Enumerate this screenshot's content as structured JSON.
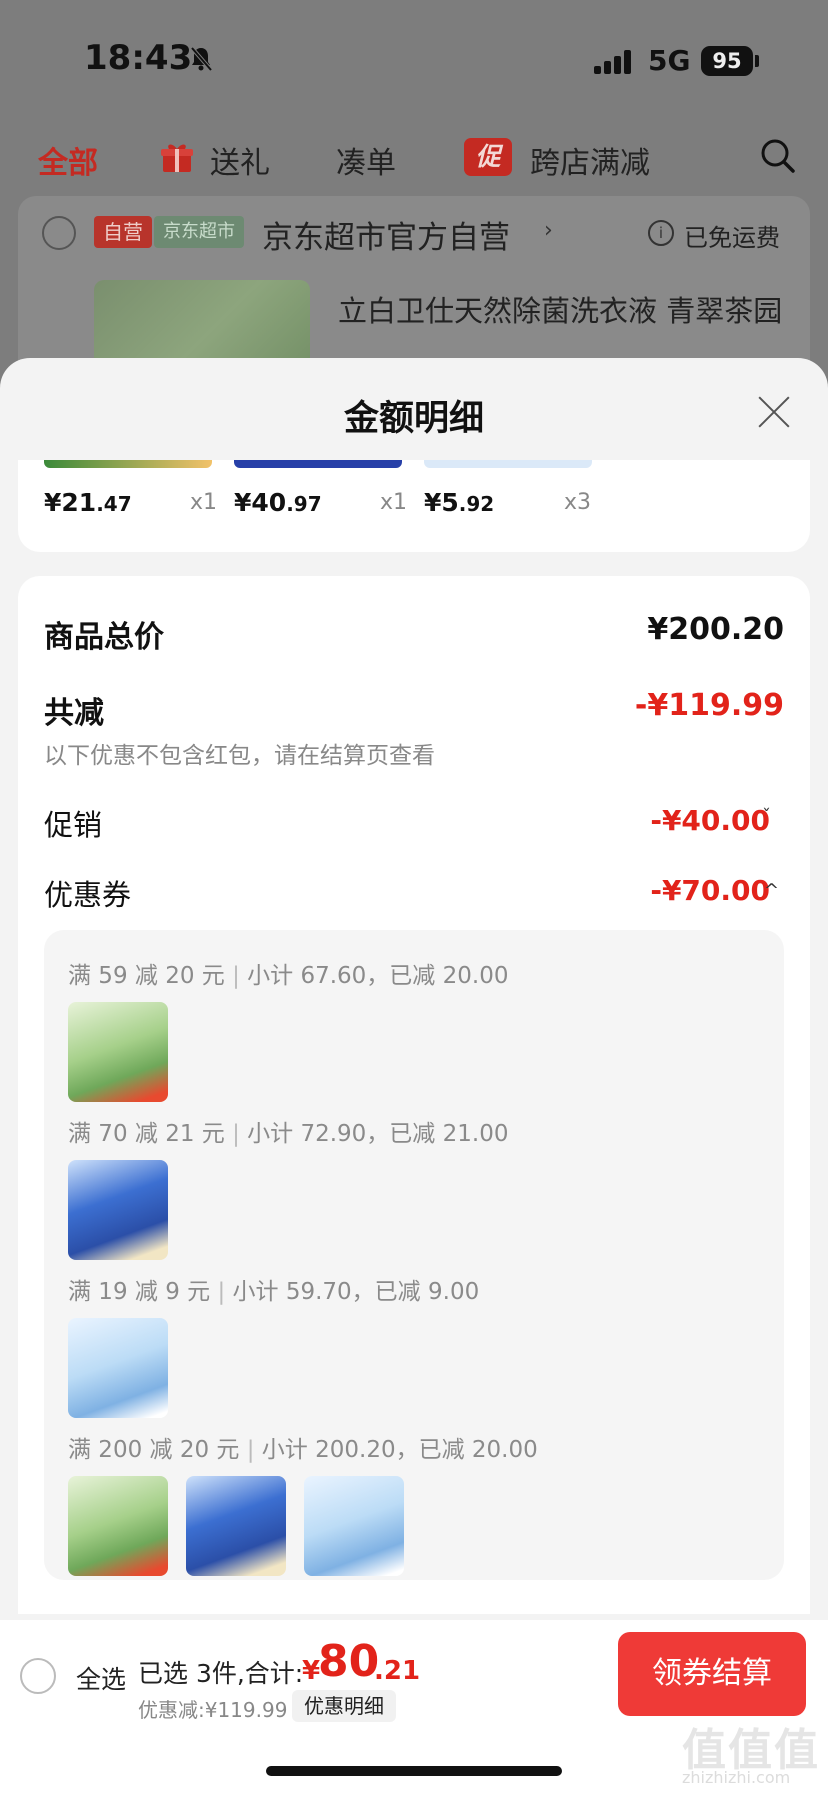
{
  "status": {
    "time": "18:43",
    "network": "5G",
    "battery": "95"
  },
  "tabs": [
    {
      "label": "全部"
    },
    {
      "label": "送礼"
    },
    {
      "label": "凑单"
    },
    {
      "label": "跨店满减"
    }
  ],
  "tabs_cu_badge": "促",
  "store": {
    "tag_self": "自营",
    "tag_market": "京东超市",
    "name": "京东超市官方自营",
    "chevron": "›",
    "info_glyph": "i",
    "free_shipping": "已免运费",
    "product_title": "立白卫仕天然除菌洗衣液 青翠茶园"
  },
  "sheet": {
    "title": "金额明细",
    "items": [
      {
        "price_int": "¥21",
        "price_dec": ".47",
        "qty": "x1"
      },
      {
        "price_int": "¥40",
        "price_dec": ".97",
        "qty": "x1"
      },
      {
        "price_int": "¥5",
        "price_dec": ".92",
        "qty": "x3"
      }
    ],
    "goods_total_label": "商品总价",
    "goods_total": "¥200.20",
    "total_reduce_label": "共减",
    "total_reduce": "-¥119.99",
    "note": "以下优惠不包含红包，请在结算页查看",
    "promo_label": "促销",
    "promo_amount": "-¥40.00",
    "promo_chevron": "ˇ",
    "coupon_label": "优惠券",
    "coupon_amount": "-¥70.00",
    "coupon_chevron": "^",
    "coupon_rules": [
      {
        "rule": "满 59 减 20 元",
        "sep": "|",
        "detail": "小计 67.60，已减 20.00"
      },
      {
        "rule": "满 70 减 21 元",
        "sep": "|",
        "detail": "小计 72.90，已减 21.00"
      },
      {
        "rule": "满 19 减 9 元",
        "sep": "|",
        "detail": "小计 59.70，已减 9.00"
      },
      {
        "rule": "满 200 减 20 元",
        "sep": "|",
        "detail": "小计 200.20，已减 20.00"
      }
    ]
  },
  "bottom": {
    "select_all": "全选",
    "selected": "已选 3件,合计:",
    "yen": "¥",
    "total_int": "80",
    "total_dec": ".21",
    "discount": "优惠减:¥119.99",
    "detail_button": "优惠明细",
    "checkout_button": "领券结算"
  },
  "watermark": {
    "main": "值值值",
    "sub": "zhizhizhi.com"
  },
  "colors": {
    "accent_red": "#e2231a",
    "checkout": "#ef3a37",
    "tab_active": "#c42a22"
  }
}
